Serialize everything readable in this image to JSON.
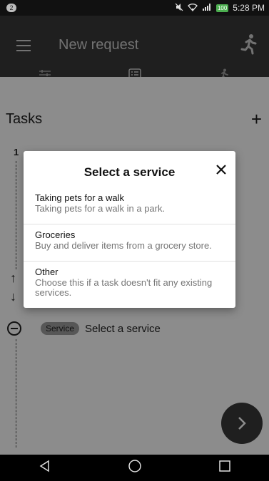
{
  "status_bar": {
    "notification_count": "2",
    "battery": "100",
    "time": "5:28 PM"
  },
  "app_bar": {
    "title": "New request",
    "menu_icon": "menu-icon",
    "runner_icon": "runner-icon"
  },
  "tabs": [
    {
      "icon": "sliders-icon"
    },
    {
      "icon": "list-icon"
    },
    {
      "icon": "runner-icon"
    }
  ],
  "tasks": {
    "title": "Tasks",
    "add_label": "+",
    "number": "1",
    "service_chip": "Service",
    "service_placeholder": "Select a service"
  },
  "dialog": {
    "title": "Select a service",
    "close_label": "✕",
    "options": [
      {
        "name": "Taking pets for a walk",
        "description": "Taking pets for a walk in a park."
      },
      {
        "name": "Groceries",
        "description": "Buy and deliver items from a grocery store."
      },
      {
        "name": "Other",
        "description": "Choose this if a task doesn't fit any existing services."
      }
    ]
  },
  "colors": {
    "app_bar": "#3a3a3a",
    "scrim": "rgba(0,0,0,0.45)",
    "fab": "#3a3a3a"
  }
}
